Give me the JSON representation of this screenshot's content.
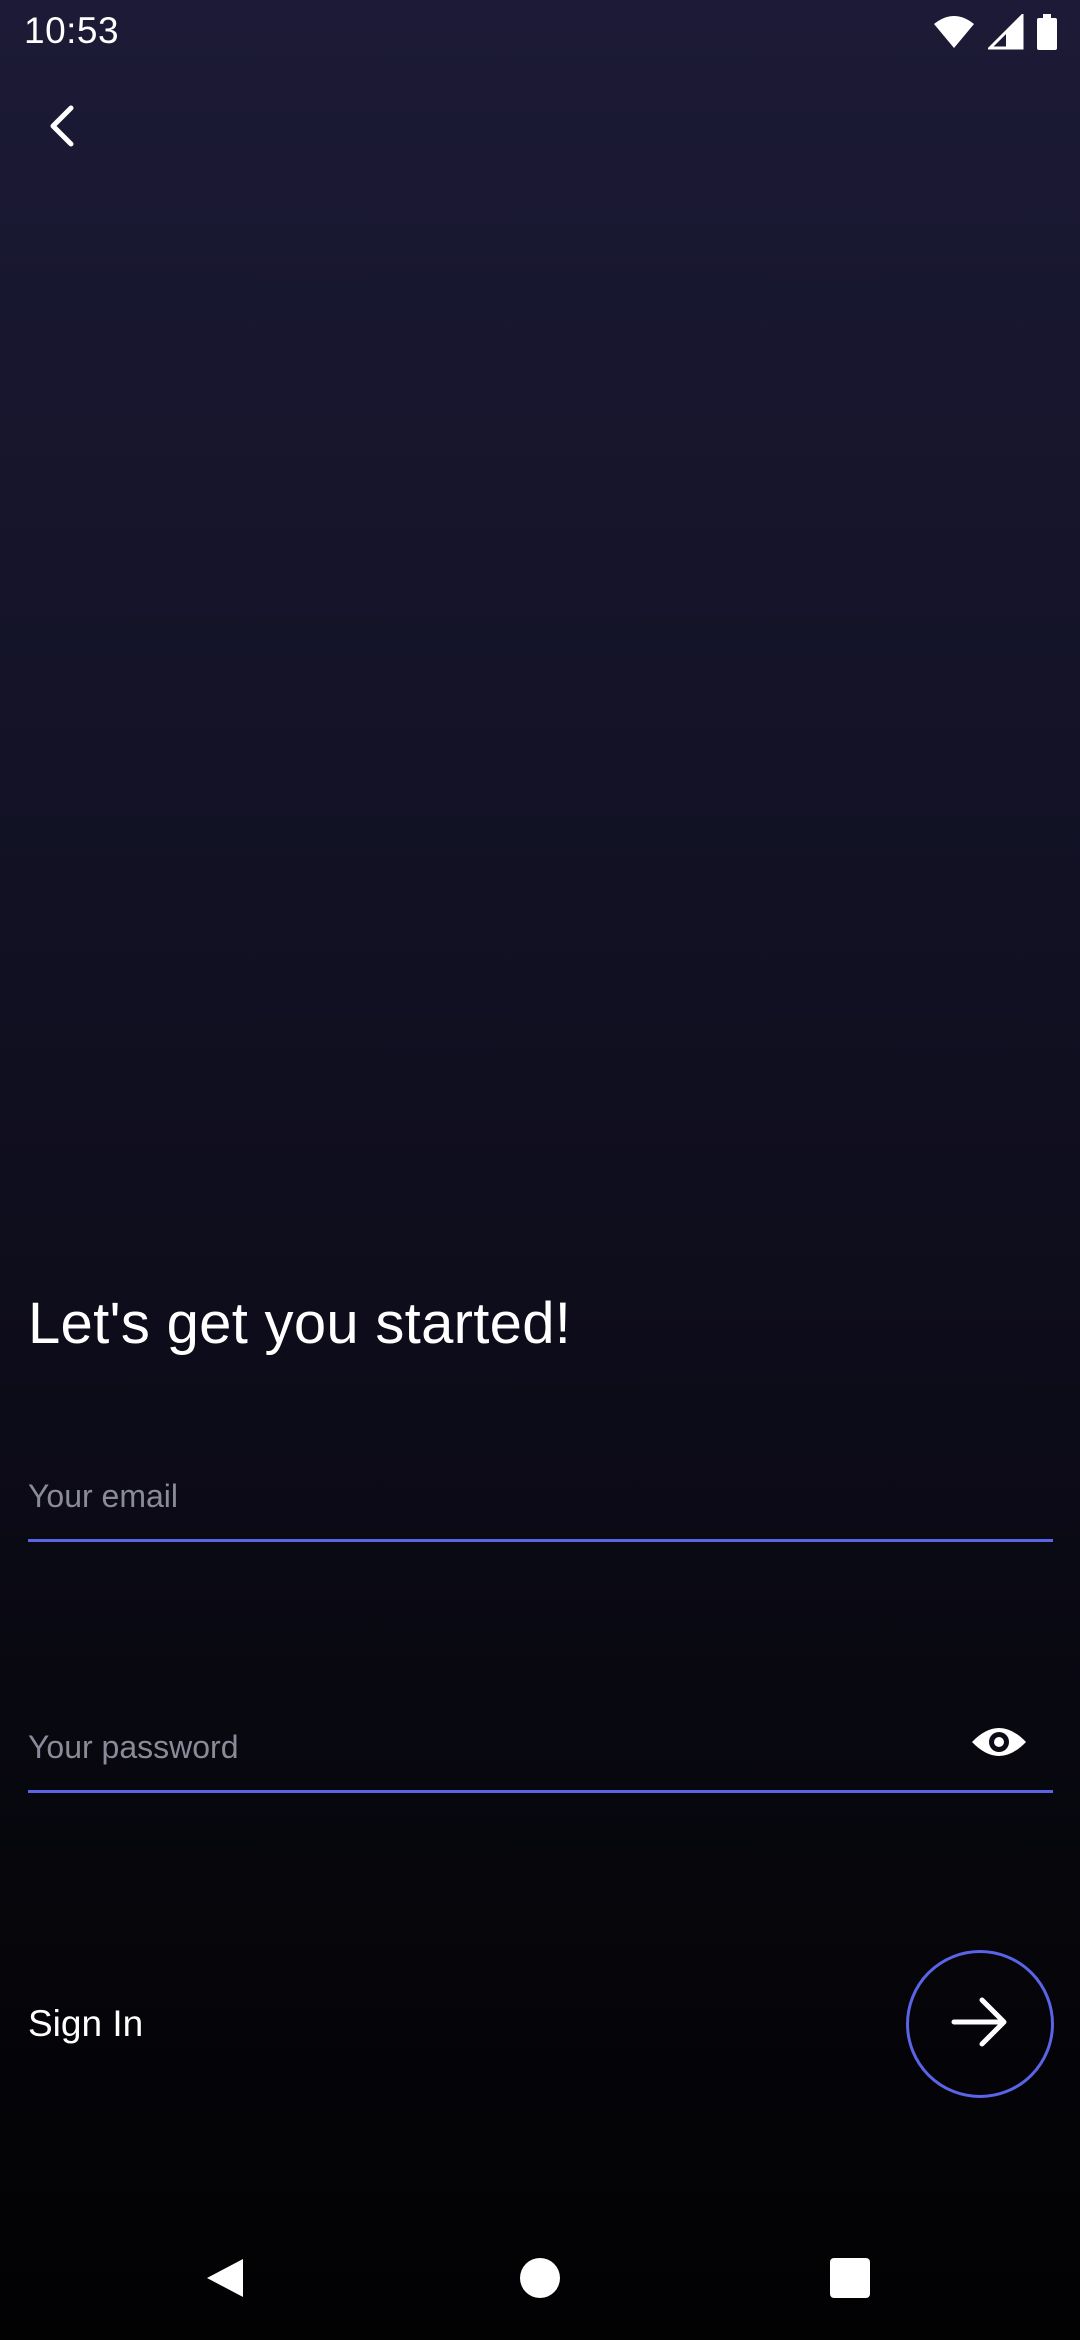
{
  "status_bar": {
    "time": "10:53",
    "icons": [
      "wifi-icon",
      "cellular-signal-icon",
      "battery-icon"
    ]
  },
  "header": {
    "back_icon": "chevron-left-icon"
  },
  "main": {
    "title": "Let's get you started!",
    "email": {
      "value": "",
      "placeholder": "Your email"
    },
    "password": {
      "value": "",
      "placeholder": "Your password",
      "toggle_icon": "eye-icon"
    },
    "signin_label": "Sign In",
    "submit_icon": "arrow-right-icon"
  },
  "nav_bar": {
    "items": [
      "back-triangle-icon",
      "home-circle-icon",
      "recents-square-icon"
    ]
  },
  "colors": {
    "accent": "#5b63e6",
    "background_top": "#1c1a36",
    "background_bottom": "#020203",
    "placeholder": "#8a8a98"
  }
}
